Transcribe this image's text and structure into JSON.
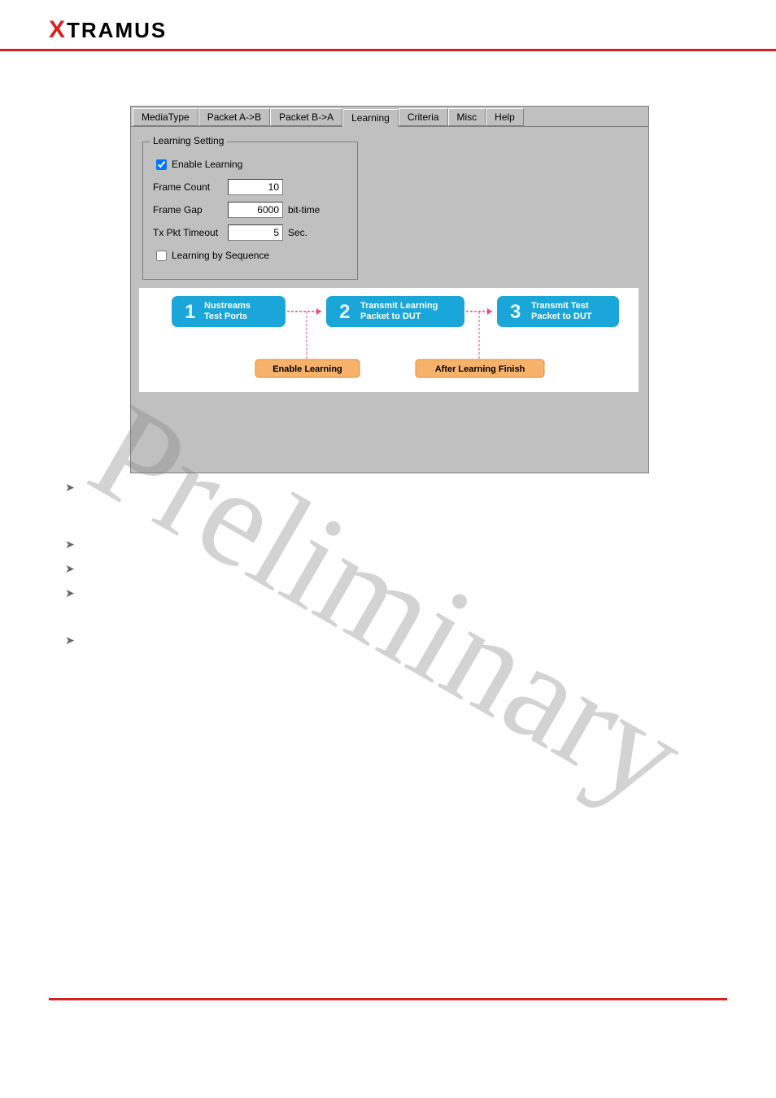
{
  "header": {
    "logo_prefix": "X",
    "logo_rest": "TRAMUS"
  },
  "watermark": "Preliminary",
  "tabs": [
    {
      "label": "MediaType",
      "active": false
    },
    {
      "label": "Packet A->B",
      "active": false
    },
    {
      "label": "Packet B->A",
      "active": false
    },
    {
      "label": "Learning",
      "active": true
    },
    {
      "label": "Criteria",
      "active": false
    },
    {
      "label": "Misc",
      "active": false
    },
    {
      "label": "Help",
      "active": false
    }
  ],
  "group": {
    "title": "Learning Setting",
    "enable_label": "Enable Learning",
    "enable_checked": true,
    "frame_count_label": "Frame Count",
    "frame_count_value": "10",
    "frame_gap_label": "Frame Gap",
    "frame_gap_value": "6000",
    "frame_gap_unit": "bit-time",
    "tx_timeout_label": "Tx Pkt Timeout",
    "tx_timeout_value": "5",
    "tx_timeout_unit": "Sec.",
    "seq_label": "Learning by Sequence",
    "seq_checked": false
  },
  "diagram": {
    "step1_num": "1",
    "step1_l1": "Nustreams",
    "step1_l2": "Test Ports",
    "step2_num": "2",
    "step2_l1": "Transmit Learning",
    "step2_l2": "Packet to DUT",
    "step3_num": "3",
    "step3_l1": "Transmit Test",
    "step3_l2": "Packet to DUT",
    "bottom1": "Enable Learning",
    "bottom2": "After Learning Finish"
  },
  "bullet_glyph": "➤"
}
